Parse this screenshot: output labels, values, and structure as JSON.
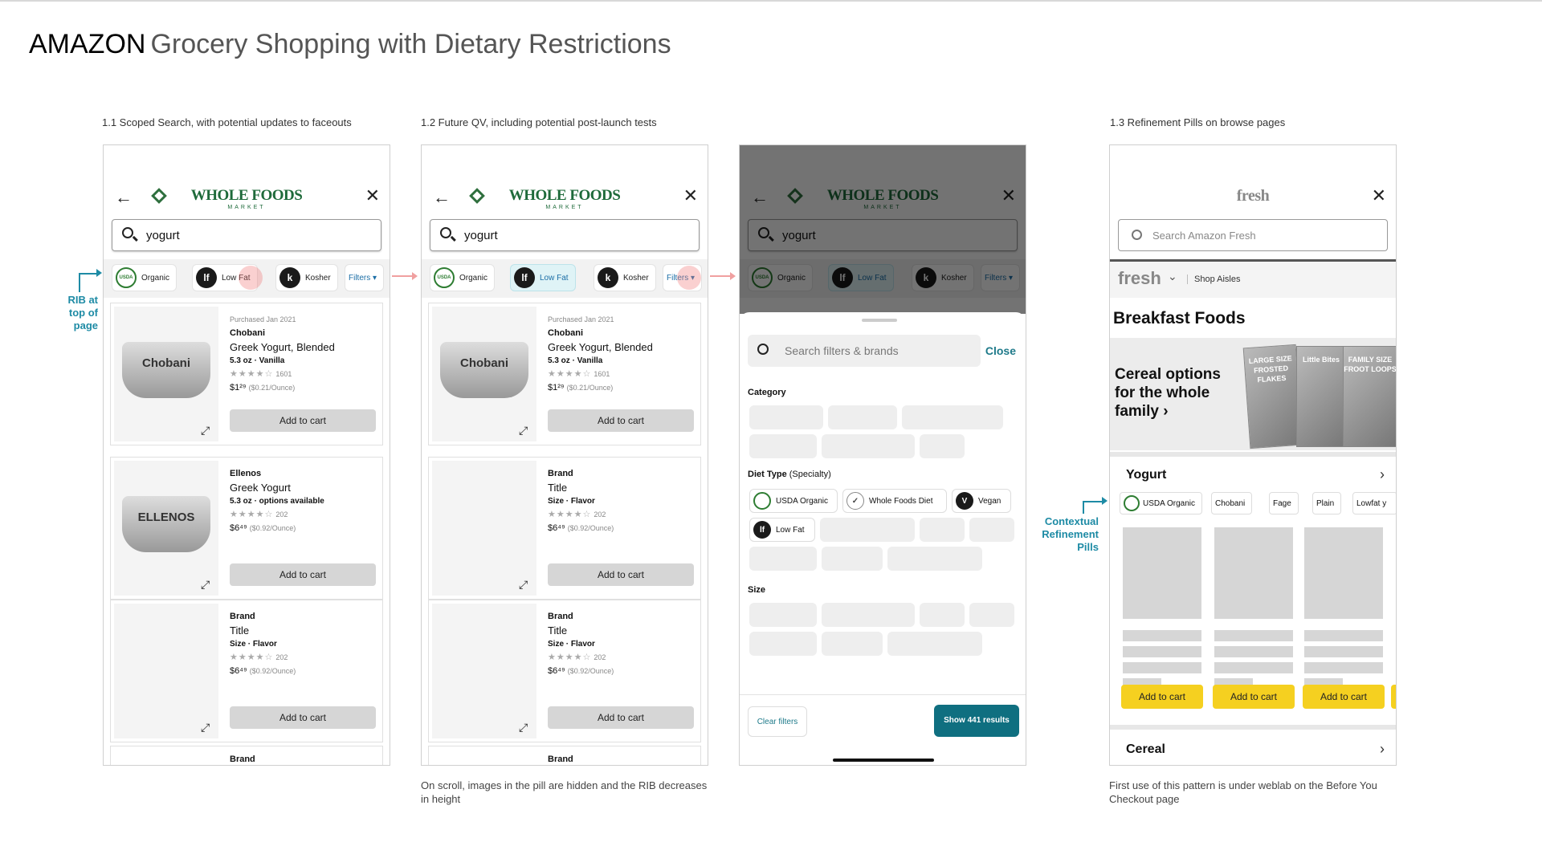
{
  "title": {
    "bold": "AMAZON",
    "light": "Grocery Shopping with Dietary Restrictions"
  },
  "captions": {
    "c1": "1.1 Scoped Search, with potential updates to faceouts",
    "c2": "1.2 Future QV, including potential post-launch tests",
    "c3": "1.3 Refinement Pills on browse pages"
  },
  "notes": {
    "n1": "On scroll, images in the pill are hidden and the RIB decreases in height",
    "n2": "First use of this pattern is under weblab on the Before You Checkout page"
  },
  "annotations": {
    "rib": "RIB at top of page",
    "contextual": "Contextual Refinement Pills"
  },
  "header": {
    "logo": "WHOLE FOODS",
    "logo_sub": "MARKET",
    "back": "←",
    "close": "✕"
  },
  "search": {
    "query": "yogurt"
  },
  "pills": {
    "organic": "Organic",
    "lowfat": "Low Fat",
    "kosher": "Kosher",
    "filters": "Filters ▾",
    "lf_icon": "lf",
    "k_icon": "k"
  },
  "products": [
    {
      "purchased": "Purchased Jan 2021",
      "brand": "Chobani",
      "name": "Greek Yogurt, Blended",
      "size": "5.3 oz · Vanilla",
      "stars": "★★★★☆",
      "reviews": "1601",
      "price": "$1²⁹",
      "unit": "($0.21/Ounce)",
      "cta": "Add to cart",
      "img": "Chobani"
    },
    {
      "purchased": "",
      "brand": "Ellenos",
      "name": "Greek Yogurt",
      "size": "5.3 oz · options available",
      "stars": "★★★★☆",
      "reviews": "202",
      "price": "$6⁴⁹",
      "unit": "($0.92/Ounce)",
      "cta": "Add to cart",
      "img": "ELLENOS"
    },
    {
      "purchased": "",
      "brand": "Brand",
      "name": "Title",
      "size": "Size · Flavor",
      "stars": "★★★★☆",
      "reviews": "202",
      "price": "$6⁴⁹",
      "unit": "($0.92/Ounce)",
      "cta": "Add to cart",
      "img": ""
    }
  ],
  "tail_brand": "Brand",
  "filters": {
    "search_placeholder": "Search filters & brands",
    "close": "Close",
    "category": "Category",
    "diet_type": "Diet Type",
    "diet_type_sub": "(Specialty)",
    "diet": [
      "USDA Organic",
      "Whole Foods Diet",
      "Vegan",
      "Low Fat"
    ],
    "vegan_icon": "V",
    "lowfat_icon": "lf",
    "size": "Size",
    "clear": "Clear filters",
    "show": "Show 441 results"
  },
  "fresh": {
    "logo": "fresh",
    "search_placeholder": "Search Amazon Fresh",
    "bar_logo": "fresh",
    "shop_aisles": "Shop Aisles",
    "page_title": "Breakfast Foods",
    "banner": "Cereal options for the whole family ›",
    "boxes": [
      "LARGE SIZE FROSTED FLAKES",
      "Little Bites",
      "FAMILY SIZE FROOT LOOPS"
    ],
    "section1": "Yogurt",
    "pills": [
      "USDA Organic",
      "Chobani",
      "Fage",
      "Plain",
      "Lowfat y"
    ],
    "cta": "Add to cart",
    "section2": "Cereal"
  }
}
